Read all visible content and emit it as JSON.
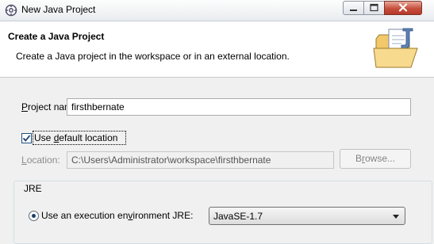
{
  "window": {
    "title": "New Java Project"
  },
  "header": {
    "title": "Create a Java Project",
    "description": "Create a Java project in the workspace or in an external location."
  },
  "form": {
    "project_name_label_mnemonic": "P",
    "project_name_label_rest": "roject name:",
    "project_name_value": "firsthbernate",
    "use_default_location_checked": true,
    "use_default_location_label_prefix": "Use ",
    "use_default_location_label_mnemonic": "d",
    "use_default_location_label_rest": "efault location",
    "location_label_mnemonic": "L",
    "location_label_rest": "ocation:",
    "location_value": "C:\\Users\\Administrator\\workspace\\firsthbernate",
    "browse_label_prefix": "B",
    "browse_label_mnemonic": "r",
    "browse_label_rest": "owse..."
  },
  "jre": {
    "group_label": "JRE",
    "option_label_prefix": "Use an execution en",
    "option_label_mnemonic": "v",
    "option_label_rest": "ironment JRE:",
    "option_selected": true,
    "selected_environment": "JavaSE-1.7"
  },
  "colors": {
    "close_button": "#c74f3c",
    "checkbox_accent": "#1c5180"
  },
  "icons": [
    "app-icon",
    "minimize-icon",
    "maximize-icon",
    "close-icon",
    "java-project-folder-icon",
    "checkmark-icon",
    "dropdown-arrow-icon"
  ]
}
